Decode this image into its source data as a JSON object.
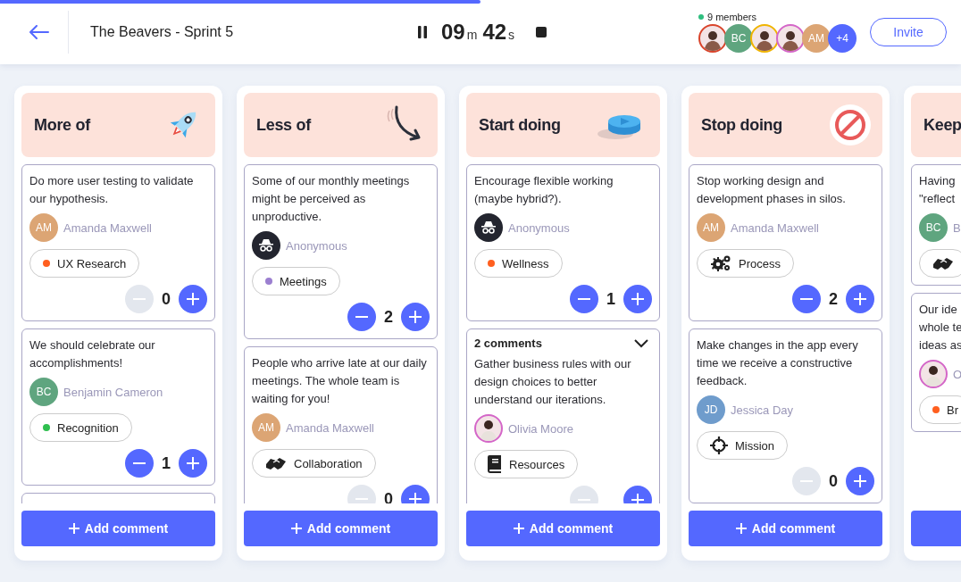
{
  "progress": {
    "level": 0.5
  },
  "title": "The Beavers - Sprint 5",
  "timer": {
    "running": true,
    "minutes": "09",
    "minutes_unit": "m",
    "seconds": "42",
    "seconds_unit": "s"
  },
  "members": {
    "label": "9 members",
    "avatars": [
      {
        "kind": "photo",
        "color": "#d9442b"
      },
      {
        "kind": "initials",
        "initials": "BC",
        "color": "#5fa57f"
      },
      {
        "kind": "photo",
        "color": "#f0b400"
      },
      {
        "kind": "photo",
        "color": "#d466c8"
      },
      {
        "kind": "initials",
        "initials": "AM",
        "color": "#dca574"
      },
      {
        "kind": "more",
        "initials": "+4",
        "color": "#5468ff"
      }
    ]
  },
  "invite": "Invite",
  "columns": [
    {
      "title": "More of",
      "add_button": "Add comment",
      "cards": [
        {
          "kind": "comment",
          "text": "Do more user testing to validate our hypothesis.",
          "author": {
            "kind": "initials",
            "initials": "AM",
            "name": "Amanda Maxwell",
            "color": "#dca574"
          },
          "tag": {
            "kind": "dot",
            "label": "UX Research",
            "color": "#ff5f1f"
          },
          "votes": {
            "count": "0",
            "can_decrease": false
          }
        },
        {
          "kind": "comment",
          "text": "We should celebrate our accomplishments!",
          "author": {
            "kind": "initials",
            "initials": "BC",
            "name": "Benjamin Cameron",
            "color": "#5fa57f"
          },
          "tag": {
            "kind": "dot",
            "label": "Recognition",
            "color": "#2fbf4f"
          },
          "votes": {
            "count": "1",
            "can_decrease": true
          }
        },
        {
          "kind": "edge"
        }
      ]
    },
    {
      "title": "Less of",
      "add_button": "Add comment",
      "cards": [
        {
          "kind": "comment",
          "text": "Some of our monthly meetings might be perceived as unproductive.",
          "author": {
            "kind": "anonymous",
            "name": "Anonymous"
          },
          "tag": {
            "kind": "dot",
            "label": "Meetings",
            "color": "#9b7fd0"
          },
          "votes": {
            "count": "2",
            "can_decrease": true
          }
        },
        {
          "kind": "comment",
          "text": "People who arrive late at our daily meetings. The whole team is waiting for you!",
          "author": {
            "kind": "initials",
            "initials": "AM",
            "name": "Amanda Maxwell",
            "color": "#dca574"
          },
          "tag": {
            "kind": "handshake",
            "label": "Collaboration"
          },
          "votes": {
            "count": "0",
            "can_decrease": false
          }
        }
      ]
    },
    {
      "title": "Start doing",
      "add_button": "Add comment",
      "cards": [
        {
          "kind": "comment",
          "text": "Encourage flexible working (maybe hybrid?).",
          "author": {
            "kind": "anonymous",
            "name": "Anonymous"
          },
          "tag": {
            "kind": "dot",
            "label": "Wellness",
            "color": "#ff5f1f"
          },
          "votes": {
            "count": "1",
            "can_decrease": true
          }
        },
        {
          "kind": "comment",
          "comments": "2 comments",
          "text": "Gather business rules with our design choices to better understand our iterations.",
          "author": {
            "kind": "photo",
            "name": "Olivia Moore",
            "color": "#d466c8"
          },
          "tag": {
            "kind": "book",
            "label": "Resources"
          },
          "votes": {
            "can_decrease": false
          }
        }
      ]
    },
    {
      "title": "Stop doing",
      "add_button": "Add comment",
      "cards": [
        {
          "kind": "comment",
          "text": "Stop working design and development phases in silos.",
          "author": {
            "kind": "initials",
            "initials": "AM",
            "name": "Amanda Maxwell",
            "color": "#dca574"
          },
          "tag": {
            "kind": "gears",
            "label": "Process"
          },
          "votes": {
            "count": "2",
            "can_decrease": true
          }
        },
        {
          "kind": "comment",
          "text": "Make changes in the app every time we receive a constructive feedback.",
          "author": {
            "kind": "initials",
            "initials": "JD",
            "name": "Jessica Day",
            "color": "#6f9ccc"
          },
          "tag": {
            "kind": "target",
            "label": "Mission"
          },
          "votes": {
            "count": "0",
            "can_decrease": false
          }
        }
      ]
    },
    {
      "title": "Keep",
      "cards": [
        {
          "kind": "comment",
          "text": "Having\n\"reflect",
          "author": {
            "kind": "initials",
            "initials": "BC",
            "name": "B",
            "color": "#5fa57f"
          },
          "tag": {
            "kind": "handshake"
          }
        },
        {
          "kind": "comment",
          "text": "Our ide\nwhole te\nideas as",
          "author": {
            "kind": "photo",
            "name": "O",
            "color": "#d466c8"
          },
          "tag": {
            "kind": "dot",
            "label": "Br",
            "color": "#ff5f1f"
          }
        }
      ]
    }
  ]
}
